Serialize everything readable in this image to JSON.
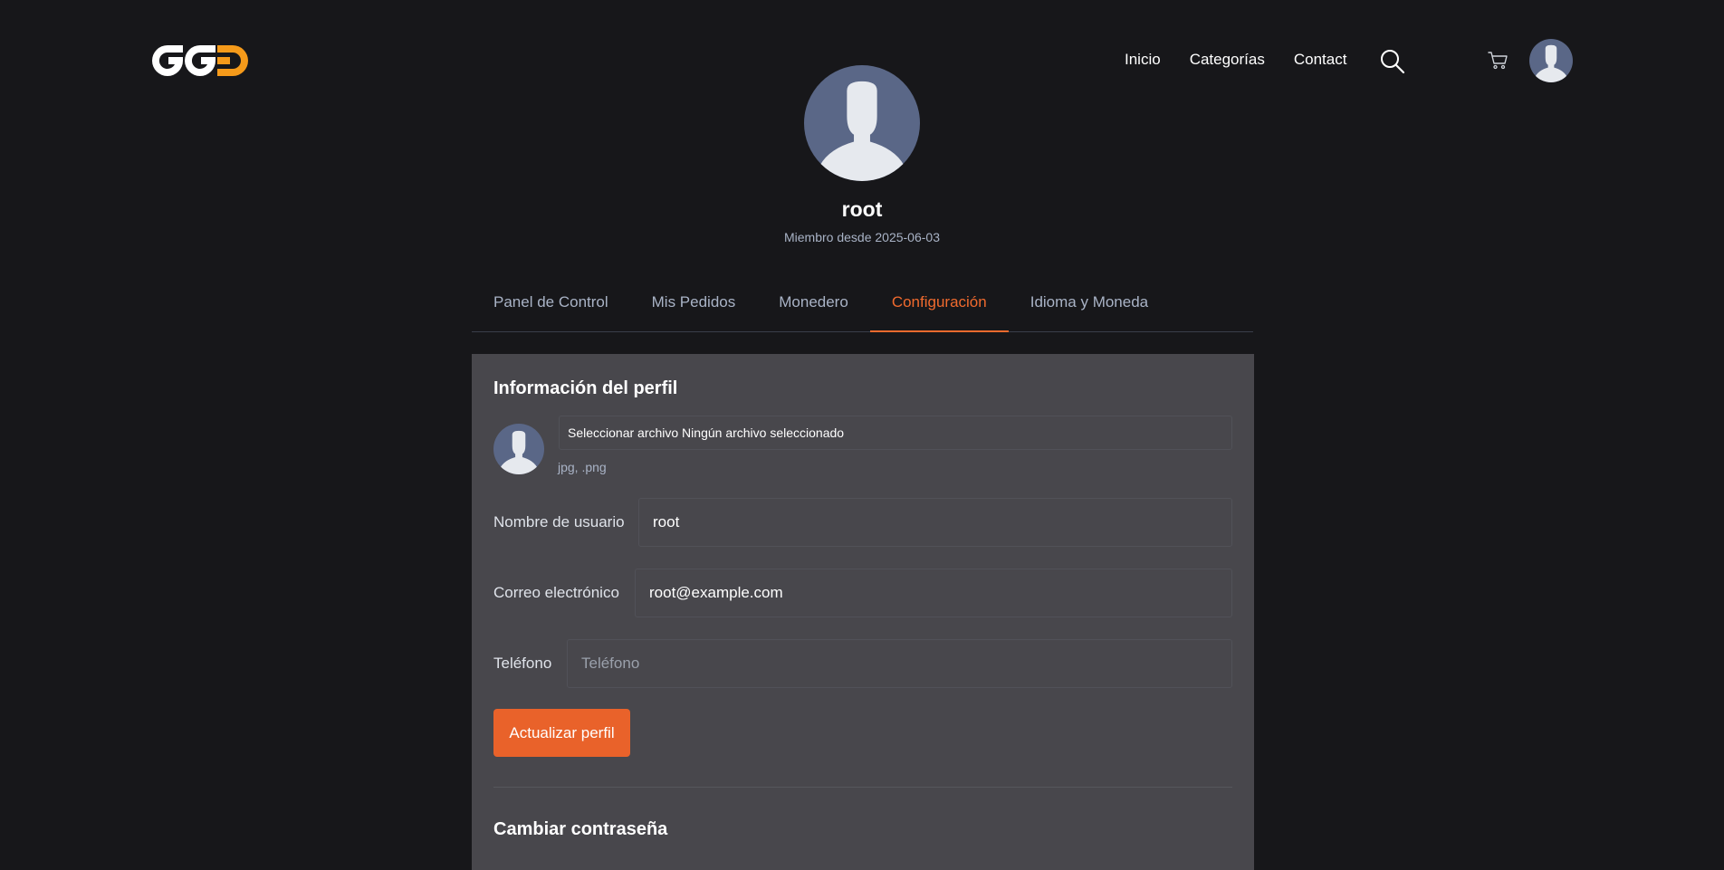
{
  "header": {
    "logo_alt": "GG",
    "nav": [
      "Inicio",
      "Categorías",
      "Contact"
    ]
  },
  "profile": {
    "username": "root",
    "member_since": "Miembro desde 2025-06-03"
  },
  "tabs": [
    {
      "label": "Panel de Control",
      "active": false
    },
    {
      "label": "Mis Pedidos",
      "active": false
    },
    {
      "label": "Monedero",
      "active": false
    },
    {
      "label": "Configuración",
      "active": true
    },
    {
      "label": "Idioma y Moneda",
      "active": false
    }
  ],
  "profile_section": {
    "title": "Información del perfil",
    "file_input": "Seleccionar archivo Ningún archivo seleccionado",
    "file_hint": "jpg, .png",
    "username_label": "Nombre de usuario",
    "username_value": "root",
    "email_label": "Correo electrónico",
    "email_value": "root@example.com",
    "phone_label": "Teléfono",
    "phone_placeholder": "Teléfono",
    "submit": "Actualizar perfil"
  },
  "password_section": {
    "title": "Cambiar contraseña"
  },
  "colors": {
    "background": "#17171a",
    "card": "#48474c",
    "accent": "#e9622a",
    "active_tab": "#f06a2e",
    "logo_accent": "#f59a1a"
  },
  "icons": {
    "search": "search-icon",
    "cart": "cart-icon",
    "avatar": "default-user-avatar"
  }
}
